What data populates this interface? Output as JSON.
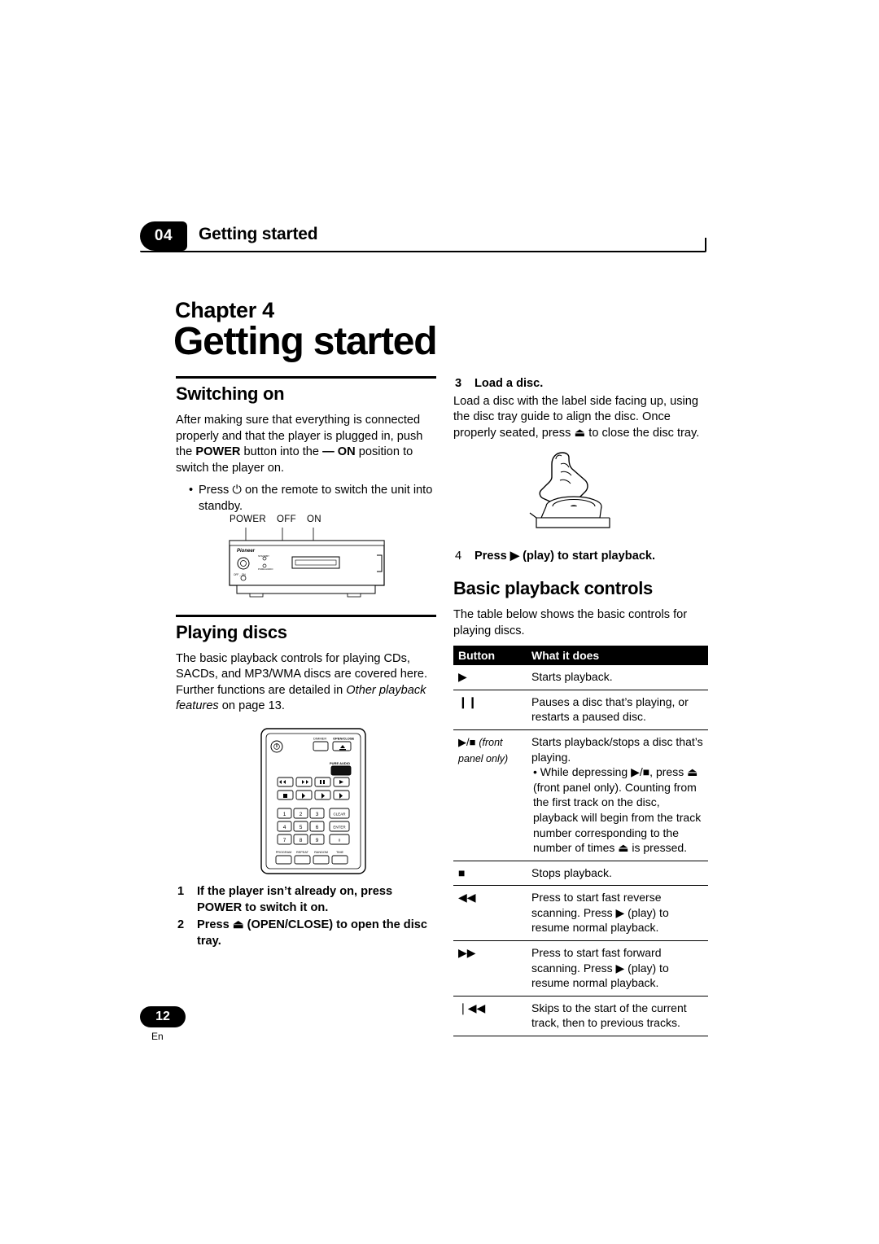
{
  "header": {
    "chapter_number": "04",
    "chapter_name": "Getting started"
  },
  "chapter": {
    "label": "Chapter 4",
    "title": "Getting started"
  },
  "left_column": {
    "switching_on": {
      "heading": "Switching on",
      "paragraph_1": "After making sure that everything is connected properly and that the player is plugged in, push the ",
      "paragraph_1_bold_1": "POWER",
      "paragraph_1_mid": " button into the ",
      "paragraph_1_bold_2": "— ON",
      "paragraph_1_end": " position to switch the player on.",
      "bullet_1": "Press ⏻ on the remote to switch the unit into standby."
    },
    "front_panel_figure": {
      "label_power": "POWER",
      "label_off": "OFF",
      "label_on": "ON",
      "brand": "Pioneer"
    },
    "playing_discs": {
      "heading": "Playing discs",
      "paragraph_1a": "The basic playback controls for playing CDs, SACDs, and MP3/WMA discs are covered here. Further functions are detailed in ",
      "paragraph_1_italic": "Other playback features",
      "paragraph_1b": " on page 13."
    },
    "remote_figure": {
      "open_close_label": "OPEN/CLOSE",
      "standby_label": "STANDBY",
      "pure_audio_label": "PURE AUDIO",
      "keys": [
        "1",
        "2",
        "3",
        "4",
        "5",
        "6",
        "7",
        "8",
        "9",
        "0"
      ],
      "clear_label": "CLEAR",
      "enter_label": "ENTER",
      "bottom_labels": [
        "PROGRAM",
        "REPEAT",
        "RANDOM",
        "TIME"
      ]
    },
    "steps": [
      {
        "num": "1",
        "text": "If the player isn’t already on, press POWER to switch it on."
      },
      {
        "num": "2",
        "text": "Press ⏏ (OPEN/CLOSE) to open the disc tray."
      }
    ]
  },
  "right_column": {
    "step_3": {
      "num": "3",
      "title": "Load a disc.",
      "text": "Load a disc with the label side facing up, using the disc tray guide to align the disc. Once properly seated, press ⏏ to close the disc tray."
    },
    "step_4": {
      "num": "4",
      "text": "Press ▶ (play) to start playback."
    },
    "basic_playback": {
      "heading": "Basic playback controls",
      "intro": "The table below shows the basic controls for playing discs."
    },
    "table": {
      "headers": [
        "Button",
        "What it does"
      ],
      "rows": [
        {
          "button": "▶",
          "desc": "Starts playback."
        },
        {
          "button": "❙❙",
          "desc": "Pauses a disc that’s playing, or restarts a paused disc."
        },
        {
          "button": "▶/■",
          "button_note": "(front panel only)",
          "desc": "Starts playback/stops a disc that’s playing.",
          "sub": "• While depressing ▶/■, press ⏏ (front panel only). Counting from the first track on the disc, playback will begin from the track number corresponding to the number of times ⏏ is pressed."
        },
        {
          "button": "■",
          "desc": "Stops playback."
        },
        {
          "button": "◀◀",
          "desc": "Press to start fast reverse scanning. Press ▶ (play) to resume normal playback."
        },
        {
          "button": "▶▶",
          "desc": "Press to start fast forward scanning. Press ▶ (play) to resume normal playback."
        },
        {
          "button": "❘◀◀",
          "desc": "Skips to the start of the current track, then to previous tracks."
        }
      ]
    }
  },
  "footer": {
    "page_number": "12",
    "language": "En"
  }
}
